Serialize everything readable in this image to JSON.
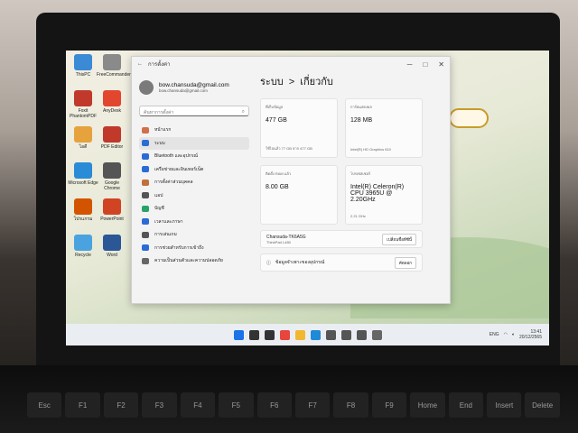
{
  "window": {
    "back": "←",
    "title": "การตั้งค่า",
    "controls": [
      "─",
      "□",
      "✕"
    ]
  },
  "profile": {
    "name": "bow.chansuda@gmail.com",
    "email": "bow.chansuda@gmail.com"
  },
  "search": {
    "placeholder": "ค้นหาการตั้งค่า"
  },
  "nav": [
    {
      "label": "หน้าแรก",
      "icon": "home-icon",
      "color": "#d0704a"
    },
    {
      "label": "ระบบ",
      "icon": "system-icon",
      "color": "#2b6bd6"
    },
    {
      "label": "Bluetooth และอุปกรณ์",
      "icon": "bluetooth-icon",
      "color": "#2b6bd6"
    },
    {
      "label": "เครือข่ายและอินเทอร์เน็ต",
      "icon": "wifi-icon",
      "color": "#2b6bd6"
    },
    {
      "label": "การตั้งค่าส่วนบุคคล",
      "icon": "brush-icon",
      "color": "#c0703a"
    },
    {
      "label": "แอป",
      "icon": "apps-icon",
      "color": "#555555"
    },
    {
      "label": "บัญชี",
      "icon": "account-icon",
      "color": "#2aa36a"
    },
    {
      "label": "เวลาและภาษา",
      "icon": "globe-icon",
      "color": "#2b6bd6"
    },
    {
      "label": "การเล่นเกม",
      "icon": "game-icon",
      "color": "#555555"
    },
    {
      "label": "การช่วยสำหรับการเข้าถึง",
      "icon": "accessibility-icon",
      "color": "#2b6bd6"
    },
    {
      "label": "ความเป็นส่วนตัวและความปลอดภัย",
      "icon": "shield-icon",
      "color": "#666666"
    }
  ],
  "breadcrumb": {
    "parent": "ระบบ",
    "separator": ">",
    "current": "เกี่ยวกับ"
  },
  "cards": [
    {
      "label": "ที่เก็บข้อมูล",
      "value": "477 GB",
      "sub": "ใช้ไปแล้ว 77 GB จาก 477 GB"
    },
    {
      "label": "การ์ดแสดงผล",
      "value": "128 MB",
      "sub": "Intel(R) HD Graphics 610"
    },
    {
      "label": "ติดตั้ง RAM แล้ว",
      "value": "8.00 GB",
      "sub": ""
    },
    {
      "label": "โปรเซสเซอร์",
      "value": "Intel(R) Celeron(R) CPU 3965U @ 2.20GHz",
      "sub": "2.21 GHz"
    }
  ],
  "device_row": {
    "name": "Chansuda-TK6A5G",
    "model": "ThinkPad L480",
    "button": "เปลี่ยนชื่อพีซีนี้"
  },
  "spec_row": {
    "label": "ข้อมูลจำเพาะของอุปกรณ์",
    "button": "คัดลอก"
  },
  "desktop_icons": [
    {
      "label": "ThisPC",
      "color": "#3a8ad6"
    },
    {
      "label": "FreeCommander",
      "color": "#8a8a8a"
    },
    {
      "label": "Foxit PhantomPDF",
      "color": "#c0392b"
    },
    {
      "label": "AnyDesk",
      "color": "#e2462f"
    },
    {
      "label": "ไอดี",
      "color": "#e6a23c"
    },
    {
      "label": "PDF Editor",
      "color": "#c0392b"
    },
    {
      "label": "Microsoft Edge",
      "color": "#2a8bd6"
    },
    {
      "label": "Google Chrome",
      "color": "#555555"
    },
    {
      "label": "โปรแกรม",
      "color": "#d35400"
    },
    {
      "label": "PowerPoint",
      "color": "#d04423"
    },
    {
      "label": "Recycle",
      "color": "#4aa3df"
    },
    {
      "label": "Word",
      "color": "#2b5797"
    }
  ],
  "taskbar": {
    "icons": [
      {
        "name": "windows-start-icon",
        "color": "#1a73e8"
      },
      {
        "name": "search-icon",
        "color": "#333333"
      },
      {
        "name": "task-view-icon",
        "color": "#333333"
      },
      {
        "name": "chrome-icon",
        "color": "#e8453c"
      },
      {
        "name": "file-explorer-icon",
        "color": "#f2b731"
      },
      {
        "name": "edge-icon",
        "color": "#1f8ad6"
      },
      {
        "name": "store-icon",
        "color": "#555555"
      },
      {
        "name": "calendar-icon",
        "color": "#555555"
      },
      {
        "name": "camera-icon",
        "color": "#555555"
      },
      {
        "name": "settings-icon",
        "color": "#666666"
      }
    ],
    "lang": "ENG",
    "time": "13:41",
    "date": "20/12/2565"
  },
  "keyboard_keys": [
    "Esc",
    "F1",
    "F2",
    "F3",
    "F4",
    "F5",
    "F6",
    "F7",
    "F8",
    "F9",
    "Home",
    "End",
    "Insert",
    "Delete"
  ]
}
